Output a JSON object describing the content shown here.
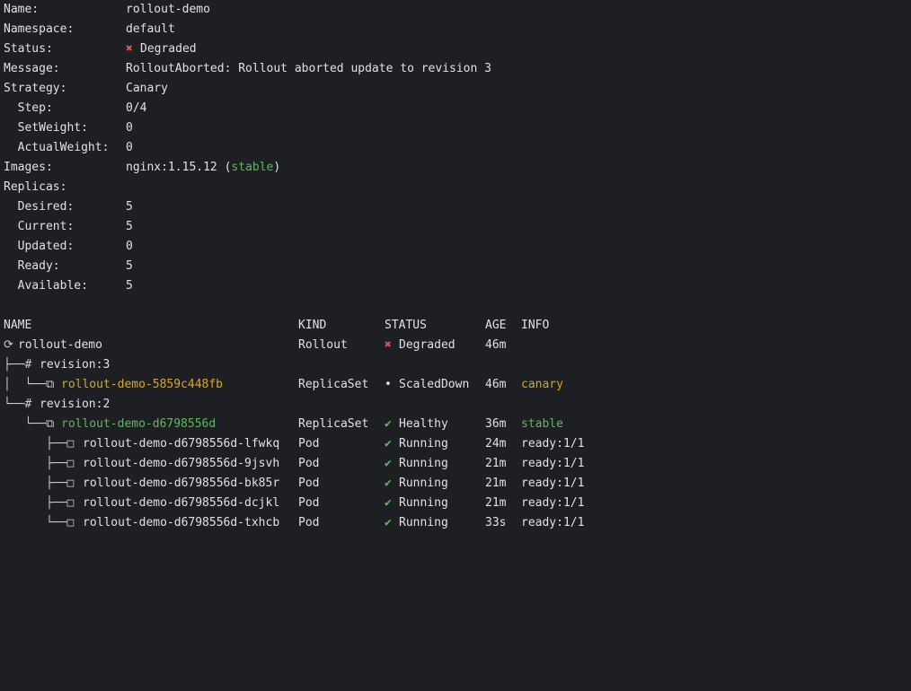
{
  "details": {
    "name_label": "Name:",
    "name_value": "rollout-demo",
    "namespace_label": "Namespace:",
    "namespace_value": "default",
    "status_label": "Status:",
    "status_icon": "✖",
    "status_value": "Degraded",
    "message_label": "Message:",
    "message_value": "RolloutAborted: Rollout aborted update to revision 3",
    "strategy_label": "Strategy:",
    "strategy_value": "Canary",
    "step_label": "  Step:",
    "step_value": "0/4",
    "setweight_label": "  SetWeight:",
    "setweight_value": "0",
    "actualweight_label": "  ActualWeight:",
    "actualweight_value": "0",
    "images_label": "Images:",
    "images_value": "nginx:1.15.12 (",
    "images_tag": "stable",
    "images_close": ")",
    "replicas_label": "Replicas:",
    "desired_label": "  Desired:",
    "desired_value": "5",
    "current_label": "  Current:",
    "current_value": "5",
    "updated_label": "  Updated:",
    "updated_value": "0",
    "ready_label": "  Ready:",
    "ready_value": "5",
    "available_label": "  Available:",
    "available_value": "5"
  },
  "table": {
    "headers": {
      "name": "NAME",
      "kind": "KIND",
      "status": "STATUS",
      "age": "AGE",
      "info": "INFO"
    },
    "rows": [
      {
        "prefix": "⟳ ",
        "name": "rollout-demo",
        "kind": "Rollout",
        "status_icon": "✖",
        "status": "Degraded",
        "age": "46m",
        "info": ""
      },
      {
        "prefix": "├──# ",
        "name": "revision:3",
        "kind": "",
        "status_icon": "",
        "status": "",
        "age": "",
        "info": ""
      },
      {
        "prefix": "│  └──⧉ ",
        "name": "rollout-demo-5859c448fb",
        "kind": "ReplicaSet",
        "status_icon": "•",
        "status": "ScaledDown",
        "age": "46m",
        "info": "canary"
      },
      {
        "prefix": "└──# ",
        "name": "revision:2",
        "kind": "",
        "status_icon": "",
        "status": "",
        "age": "",
        "info": ""
      },
      {
        "prefix": "   └──⧉ ",
        "name": "rollout-demo-d6798556d",
        "kind": "ReplicaSet",
        "status_icon": "✔",
        "status": "Healthy",
        "age": "36m",
        "info": "stable"
      },
      {
        "prefix": "      ├──□ ",
        "name": "rollout-demo-d6798556d-lfwkq",
        "kind": "Pod",
        "status_icon": "✔",
        "status": "Running",
        "age": "24m",
        "info": "ready:1/1"
      },
      {
        "prefix": "      ├──□ ",
        "name": "rollout-demo-d6798556d-9jsvh",
        "kind": "Pod",
        "status_icon": "✔",
        "status": "Running",
        "age": "21m",
        "info": "ready:1/1"
      },
      {
        "prefix": "      ├──□ ",
        "name": "rollout-demo-d6798556d-bk85r",
        "kind": "Pod",
        "status_icon": "✔",
        "status": "Running",
        "age": "21m",
        "info": "ready:1/1"
      },
      {
        "prefix": "      ├──□ ",
        "name": "rollout-demo-d6798556d-dcjkl",
        "kind": "Pod",
        "status_icon": "✔",
        "status": "Running",
        "age": "21m",
        "info": "ready:1/1"
      },
      {
        "prefix": "      └──□ ",
        "name": "rollout-demo-d6798556d-txhcb",
        "kind": "Pod",
        "status_icon": "✔",
        "status": "Running",
        "age": "33s",
        "info": "ready:1/1"
      }
    ]
  },
  "colors": {
    "background": "#1e1f22",
    "text": "#dfe1e5",
    "error": "#e0524f",
    "success": "#5fb760",
    "warning": "#d4a72c"
  }
}
